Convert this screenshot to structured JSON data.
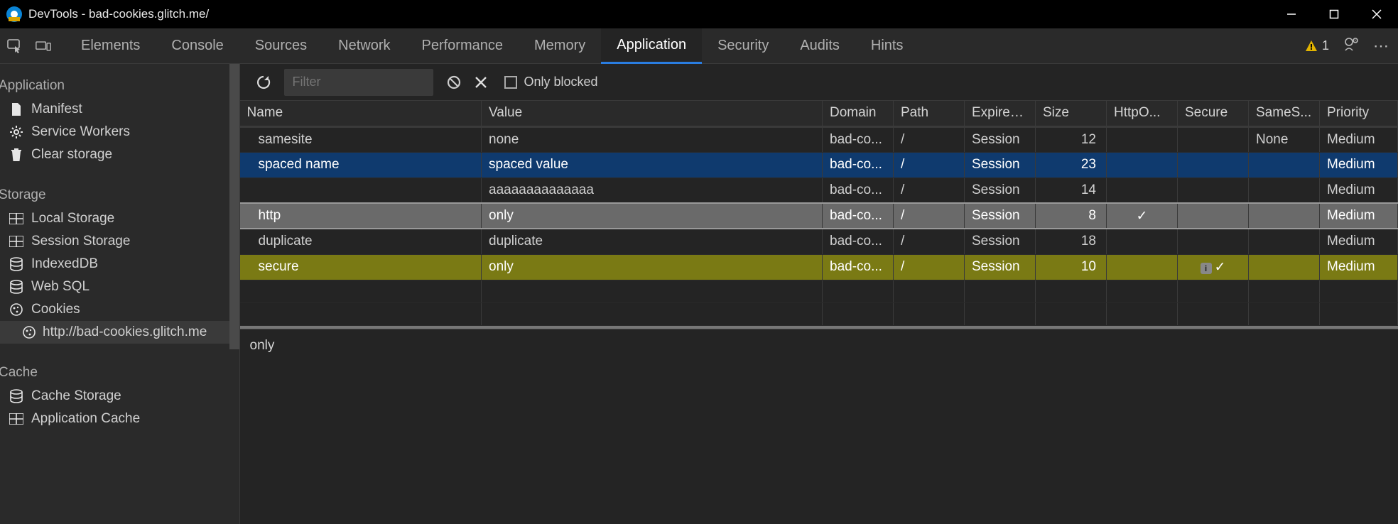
{
  "window": {
    "title": "DevTools - bad-cookies.glitch.me/"
  },
  "tabs": {
    "items": [
      "Elements",
      "Console",
      "Sources",
      "Network",
      "Performance",
      "Memory",
      "Application",
      "Security",
      "Audits",
      "Hints"
    ],
    "active": "Application",
    "warning_count": "1"
  },
  "sidebar": {
    "groups": [
      {
        "heading": "Application",
        "items": [
          {
            "icon": "doc",
            "label": "Manifest"
          },
          {
            "icon": "gear",
            "label": "Service Workers"
          },
          {
            "icon": "trash",
            "label": "Clear storage"
          }
        ]
      },
      {
        "heading": "Storage",
        "items": [
          {
            "icon": "grid",
            "label": "Local Storage"
          },
          {
            "icon": "grid",
            "label": "Session Storage"
          },
          {
            "icon": "db",
            "label": "IndexedDB"
          },
          {
            "icon": "db",
            "label": "Web SQL"
          },
          {
            "icon": "cookie",
            "label": "Cookies",
            "children": [
              {
                "icon": "cookie",
                "label": "http://bad-cookies.glitch.me"
              }
            ]
          }
        ]
      },
      {
        "heading": "Cache",
        "items": [
          {
            "icon": "db",
            "label": "Cache Storage"
          },
          {
            "icon": "grid",
            "label": "Application Cache"
          }
        ]
      }
    ]
  },
  "toolbar": {
    "filter_placeholder": "Filter",
    "only_blocked_label": "Only blocked"
  },
  "table": {
    "columns": [
      "Name",
      "Value",
      "Domain",
      "Path",
      "Expires...",
      "Size",
      "HttpO...",
      "Secure",
      "SameS...",
      "Priority"
    ],
    "rows": [
      {
        "style": "normal",
        "name": "samesite",
        "value": "none",
        "domain": "bad-co...",
        "path": "/",
        "expires": "Session",
        "size": "12",
        "httponly": "",
        "secure": "",
        "samesite": "None",
        "priority": "Medium"
      },
      {
        "style": "blue",
        "name": "spaced name",
        "value": "spaced value",
        "domain": "bad-co...",
        "path": "/",
        "expires": "Session",
        "size": "23",
        "httponly": "",
        "secure": "",
        "samesite": "",
        "priority": "Medium"
      },
      {
        "style": "normal",
        "name": "",
        "value": "aaaaaaaaaaaaaa",
        "domain": "bad-co...",
        "path": "/",
        "expires": "Session",
        "size": "14",
        "httponly": "",
        "secure": "",
        "samesite": "",
        "priority": "Medium"
      },
      {
        "style": "grey",
        "name": "http",
        "value": "only",
        "domain": "bad-co...",
        "path": "/",
        "expires": "Session",
        "size": "8",
        "httponly": "✓",
        "secure": "",
        "samesite": "",
        "priority": "Medium"
      },
      {
        "style": "normal",
        "name": "duplicate",
        "value": "duplicate",
        "domain": "bad-co...",
        "path": "/",
        "expires": "Session",
        "size": "18",
        "httponly": "",
        "secure": "",
        "samesite": "",
        "priority": "Medium"
      },
      {
        "style": "olive",
        "name": "secure",
        "value": "only",
        "domain": "bad-co...",
        "path": "/",
        "expires": "Session",
        "size": "10",
        "httponly": "",
        "secure": "ℹ ✓",
        "samesite": "",
        "priority": "Medium"
      }
    ]
  },
  "detail": {
    "value": "only"
  }
}
